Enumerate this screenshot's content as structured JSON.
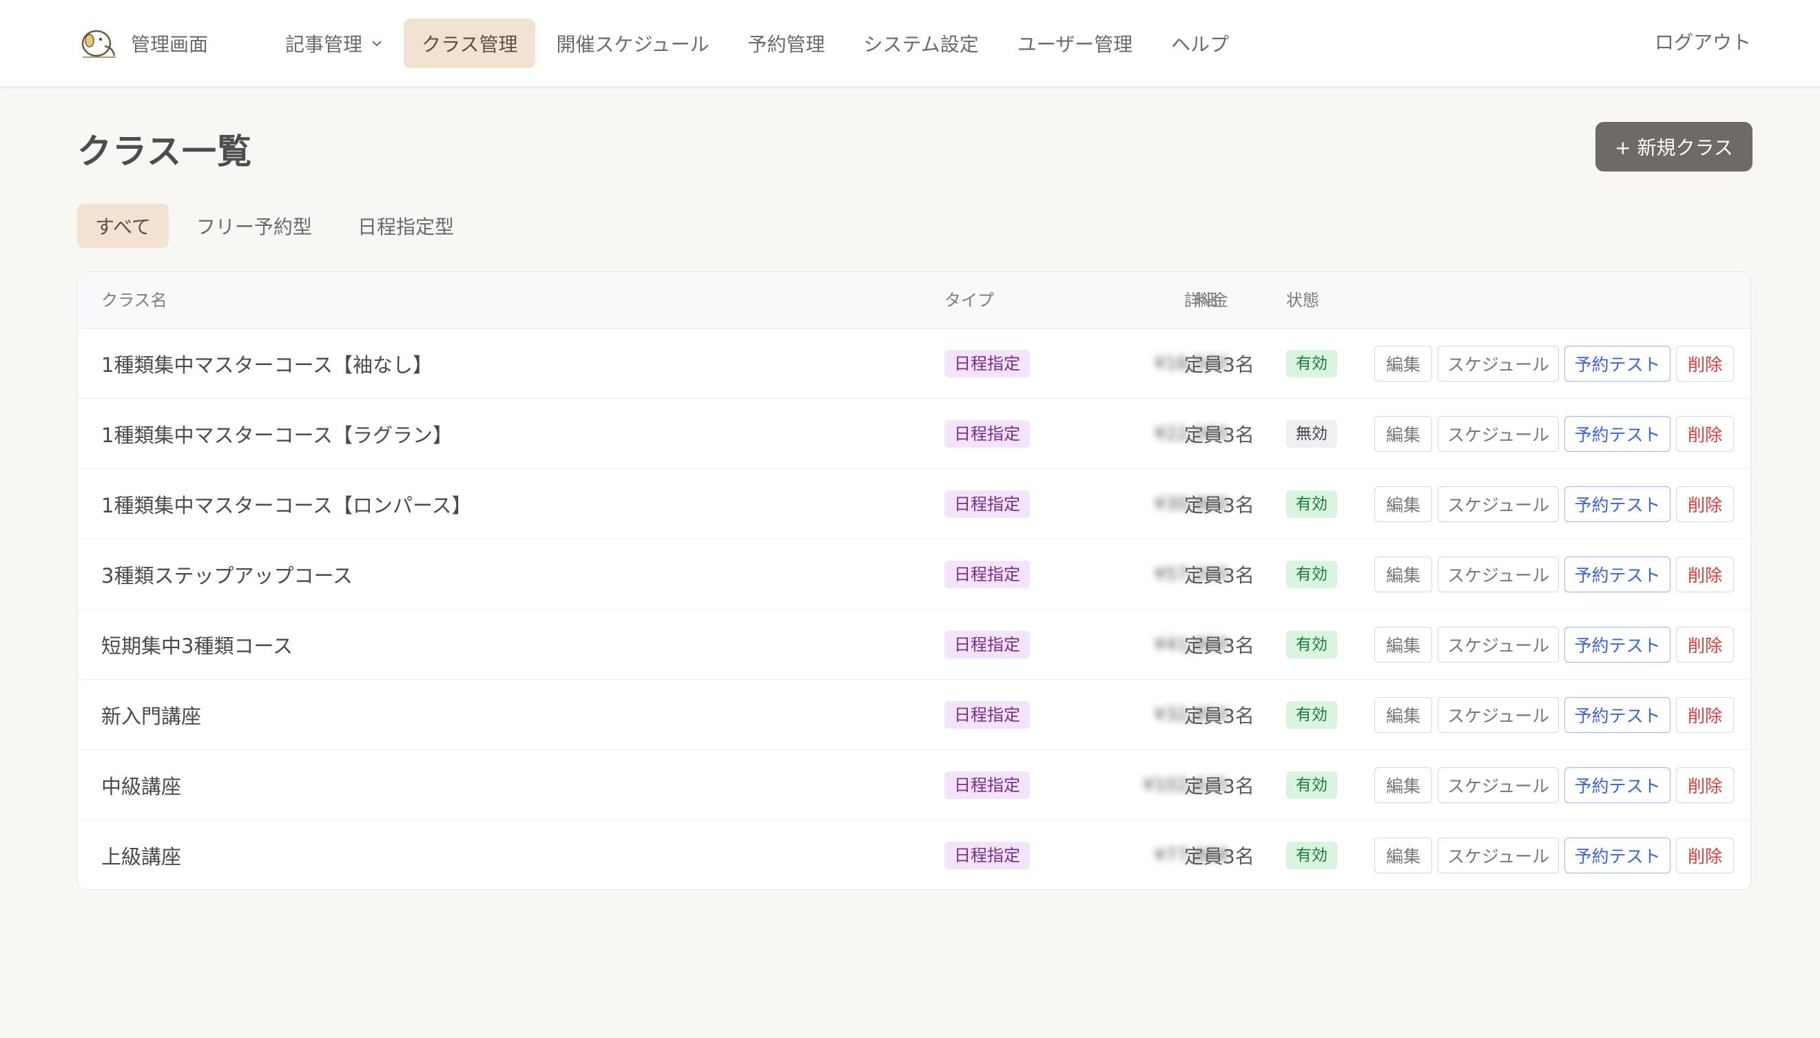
{
  "header": {
    "brand_title": "管理画面",
    "nav": [
      {
        "label": "記事管理",
        "has_dropdown": true,
        "active": false
      },
      {
        "label": "クラス管理",
        "active": true
      },
      {
        "label": "開催スケジュール",
        "active": false
      },
      {
        "label": "予約管理",
        "active": false
      },
      {
        "label": "システム設定",
        "active": false
      },
      {
        "label": "ユーザー管理",
        "active": false
      },
      {
        "label": "ヘルプ",
        "active": false
      }
    ],
    "logout_label": "ログアウト"
  },
  "page": {
    "title": "クラス一覧",
    "new_button_label": "+ 新規クラス"
  },
  "tabs": [
    {
      "label": "すべて",
      "active": true
    },
    {
      "label": "フリー予約型",
      "active": false
    },
    {
      "label": "日程指定型",
      "active": false
    }
  ],
  "table": {
    "columns": {
      "name": "クラス名",
      "type": "タイプ",
      "price": "料金",
      "detail": "詳細",
      "status": "状態"
    },
    "action_labels": {
      "edit": "編集",
      "schedule": "スケジュール",
      "test": "予約テスト",
      "delete": "削除"
    },
    "rows": [
      {
        "name": "1種類集中マスターコース【袖なし】",
        "type": "日程指定",
        "price": "¥16,500",
        "detail": "定員3名",
        "status": "有効",
        "active": true
      },
      {
        "name": "1種類集中マスターコース【ラグラン】",
        "type": "日程指定",
        "price": "¥22,000",
        "detail": "定員3名",
        "status": "無効",
        "active": false
      },
      {
        "name": "1種類集中マスターコース【ロンパース】",
        "type": "日程指定",
        "price": "¥30,800",
        "detail": "定員3名",
        "status": "有効",
        "active": true
      },
      {
        "name": "3種類ステップアップコース",
        "type": "日程指定",
        "price": "¥57,200",
        "detail": "定員3名",
        "status": "有効",
        "active": true
      },
      {
        "name": "短期集中3種類コース",
        "type": "日程指定",
        "price": "¥41,800",
        "detail": "定員3名",
        "status": "有効",
        "active": true
      },
      {
        "name": "新入門講座",
        "type": "日程指定",
        "price": "¥32,850",
        "detail": "定員3名",
        "status": "有効",
        "active": true
      },
      {
        "name": "中級講座",
        "type": "日程指定",
        "price": "¥102,635",
        "detail": "定員3名",
        "status": "有効",
        "active": true
      },
      {
        "name": "上級講座",
        "type": "日程指定",
        "price": "¥77,888",
        "detail": "定員3名",
        "status": "有効",
        "active": true
      }
    ]
  },
  "colors": {
    "accent_bg": "#f2e2d2",
    "primary_button": "#6f6a66",
    "badge_type_bg": "#f3e3fb",
    "status_on_bg": "#d9f5e0",
    "test_blue": "#3b63d8",
    "delete_red": "#dc3a3a"
  }
}
